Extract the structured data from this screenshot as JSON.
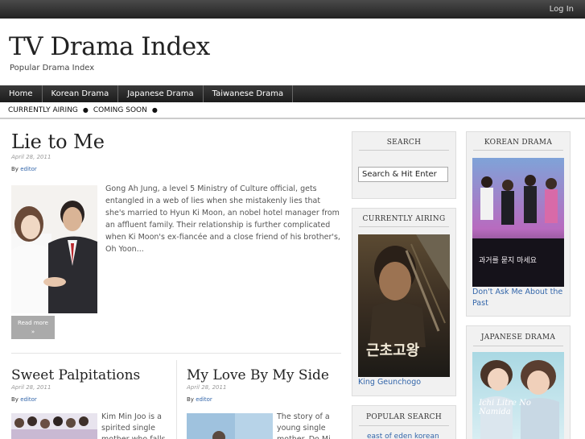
{
  "topbar": {
    "login_label": "Log In"
  },
  "site": {
    "title": "TV Drama Index",
    "description": "Popular Drama Index"
  },
  "nav": {
    "items": [
      "Home",
      "Korean Drama",
      "Japanese Drama",
      "Taiwanese Drama"
    ]
  },
  "subnav": {
    "items": [
      "CURRENTLY AIRING",
      "COMING SOON"
    ]
  },
  "posts": [
    {
      "title": "Lie to Me",
      "date": "April 28, 2011",
      "by_prefix": "By",
      "author": "editor",
      "excerpt": "Gong Ah Jung, a level 5 Ministry of Culture official, gets entangled in a web of lies when she mistakenly lies that she's married to Hyun Ki Moon, an nobel hotel manager from an affluent family. Their relationship is further complicated when Ki Moon's ex-fiancée and a close friend of his brother's, Oh Yoon...",
      "read_more": "Read more"
    },
    {
      "title": "Sweet Palpitations",
      "date": "April 28, 2011",
      "by_prefix": "By",
      "author": "editor",
      "excerpt": "Kim Min Joo is a spirited single mother who falls"
    },
    {
      "title": "My Love By My Side",
      "date": "April 28, 2011",
      "by_prefix": "By",
      "author": "editor",
      "excerpt": "The story of a young single mother. Do Mi"
    }
  ],
  "sidebar_left": {
    "search": {
      "title": "SEARCH",
      "placeholder": "Search & Hit Enter"
    },
    "currently_airing": {
      "title": "CURRENTLY AIRING",
      "link": "King Geunchogo",
      "poster_text": "근초고왕"
    },
    "popular_search": {
      "title": "POPULAR SEARCH",
      "link": "east of eden korean"
    }
  },
  "sidebar_right": {
    "korean_drama": {
      "title": "KOREAN DRAMA",
      "link": "Don't Ask Me About the Past",
      "poster_text": "과거를 묻지 마세요"
    },
    "japanese_drama": {
      "title": "JAPANESE DRAMA",
      "poster_text": "Ichi Litre No Namida"
    }
  },
  "colors": {
    "link": "#3366aa",
    "nav_bg": "#2a2a2a",
    "widget_bg": "#f1f1f1"
  }
}
